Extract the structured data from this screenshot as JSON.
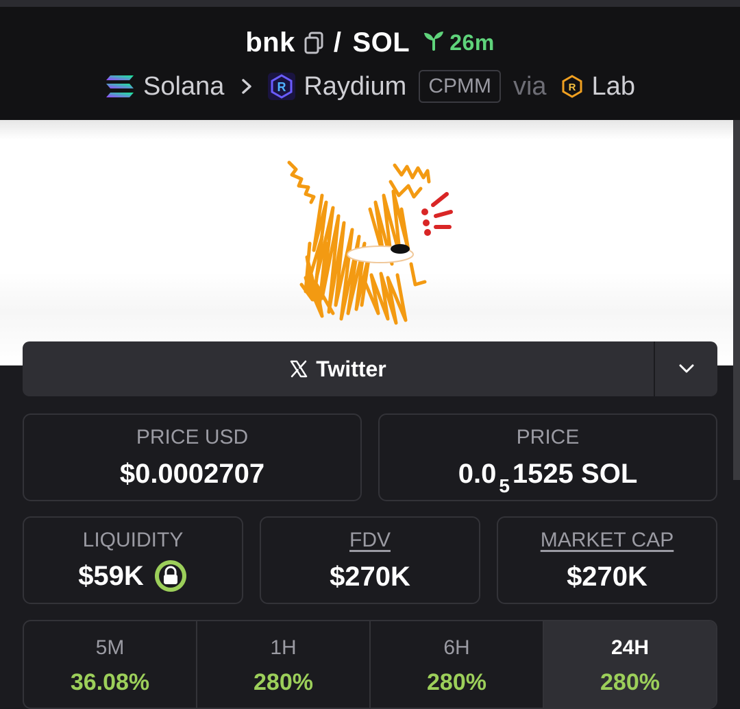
{
  "header": {
    "token": "bnk",
    "separator": "/",
    "quote": "SOL",
    "age": "26m",
    "chain": "Solana",
    "dex": "Raydium",
    "pool_type": "CPMM",
    "via": "via",
    "launchpad": "Lab"
  },
  "social": {
    "twitter_label": "Twitter"
  },
  "price_usd": {
    "label": "PRICE USD",
    "value": "$0.0002707"
  },
  "price_native": {
    "label": "PRICE",
    "prefix": "0.0",
    "subscript": "5",
    "digits": "1525",
    "unit": "SOL"
  },
  "liquidity": {
    "label": "LIQUIDITY",
    "value": "$59K"
  },
  "fdv": {
    "label": "FDV",
    "value": "$270K"
  },
  "market_cap": {
    "label": "MARKET CAP",
    "value": "$270K"
  },
  "timeframes": [
    {
      "label": "5M",
      "change": "36.08%"
    },
    {
      "label": "1H",
      "change": "280%"
    },
    {
      "label": "6H",
      "change": "280%"
    },
    {
      "label": "24H",
      "change": "280%"
    }
  ],
  "colors": {
    "positive": "#9ccf5a",
    "age": "#5fd37b",
    "background": "#1b1b1f",
    "header_bg": "#121214"
  },
  "icons": {
    "copy": "copy-icon",
    "age": "seedling-icon",
    "chain": "solana-logo-icon",
    "dex": "raydium-logo-icon",
    "launchpad": "raydium-lab-icon",
    "twitter": "x-logo-icon",
    "dropdown": "chevron-down-icon",
    "lock": "lock-icon"
  }
}
